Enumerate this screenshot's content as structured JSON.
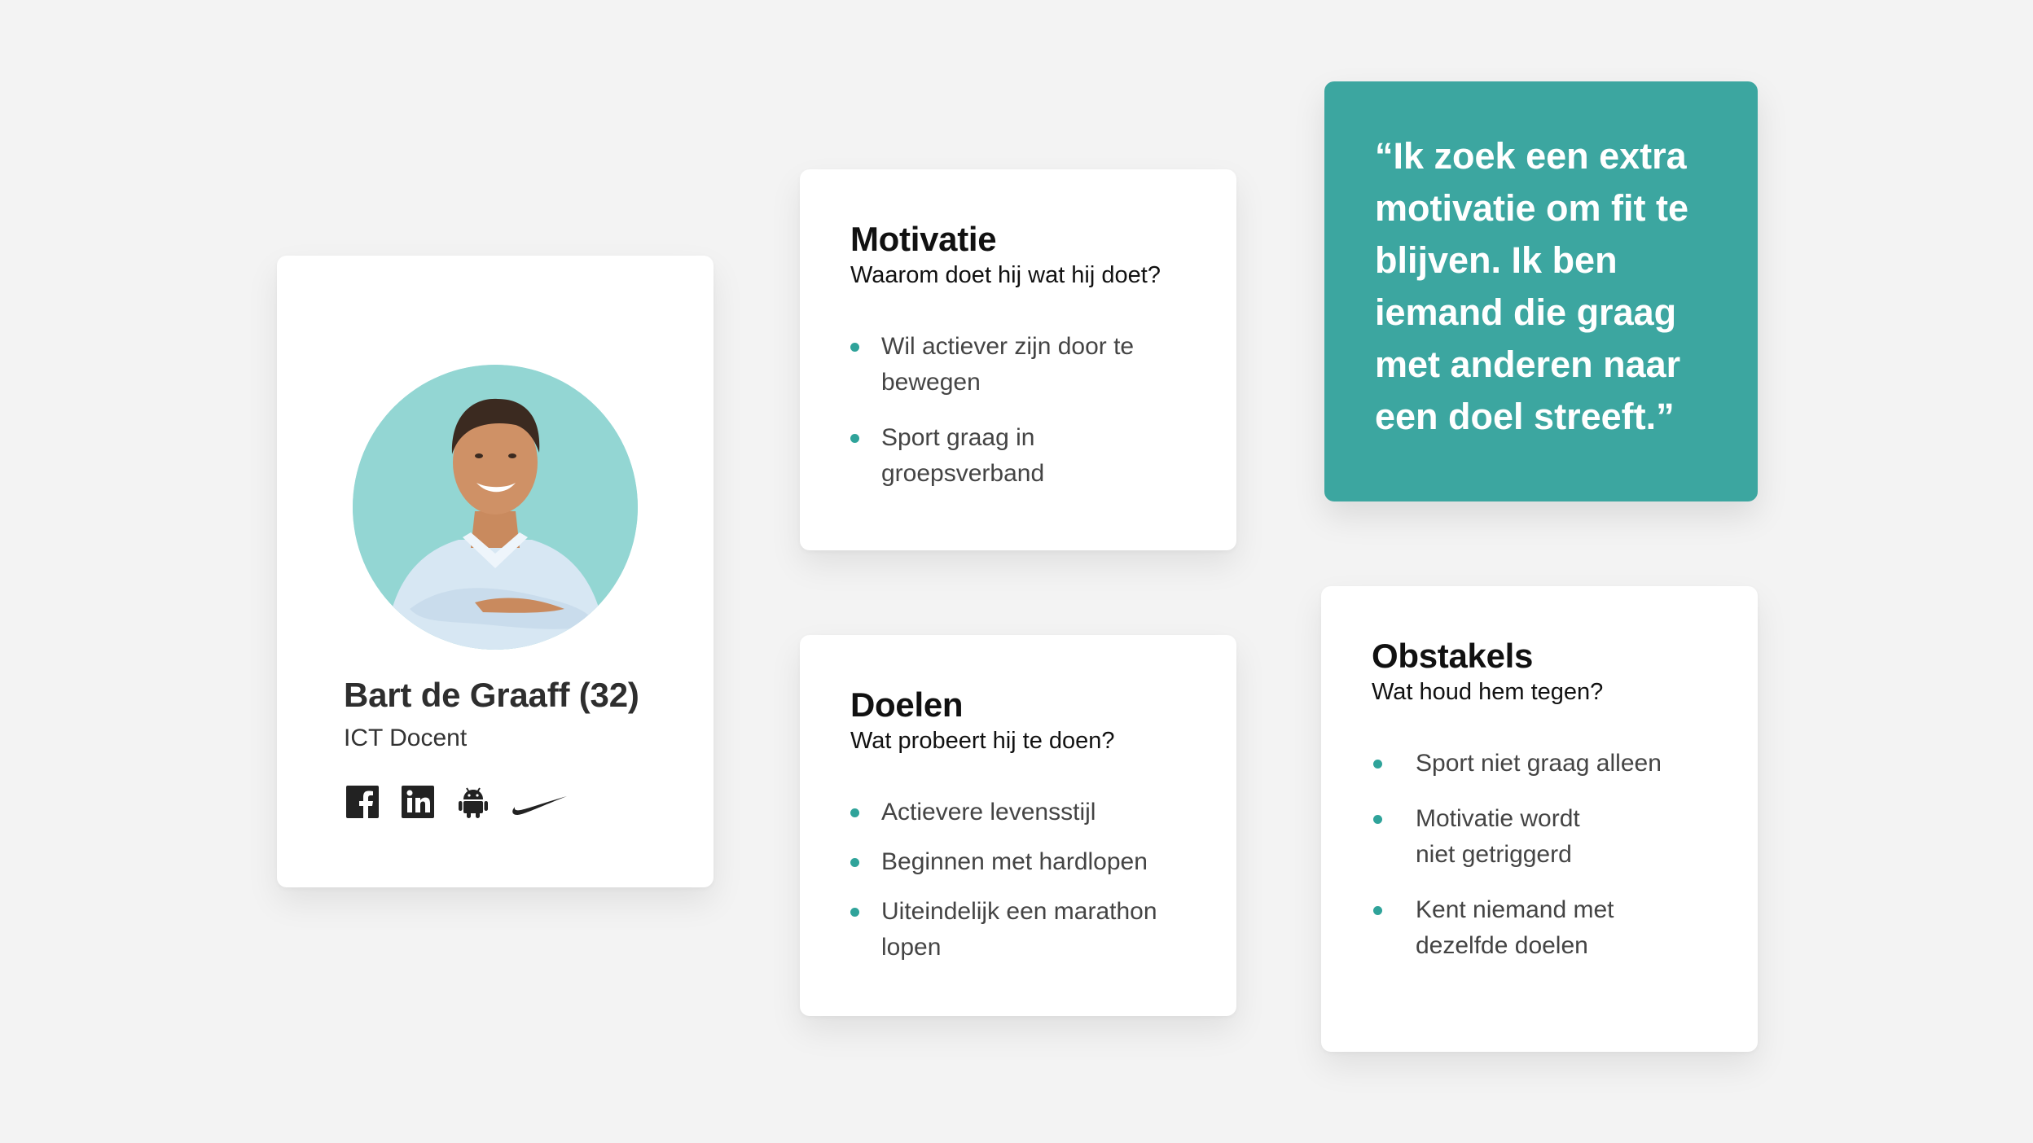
{
  "profile": {
    "name": "Bart de Graaff (32)",
    "role": "ICT Docent",
    "socials": [
      "facebook-icon",
      "linkedin-icon",
      "android-icon",
      "nike-icon"
    ],
    "avatar_bg": "#93d6d3"
  },
  "motivatie": {
    "title": "Motivatie",
    "subtitle": "Waarom doet hij wat hij doet?",
    "items": [
      [
        "Wil actiever zijn door te",
        "bewegen"
      ],
      [
        "Sport graag in",
        "groepsverband"
      ]
    ]
  },
  "doelen": {
    "title": "Doelen",
    "subtitle": "Wat probeert hij te doen?",
    "items": [
      [
        "Actievere levensstijl"
      ],
      [
        "Beginnen met hardlopen"
      ],
      [
        "Uiteindelijk een marathon",
        "lopen"
      ]
    ]
  },
  "obstakels": {
    "title": "Obstakels",
    "subtitle": "Wat houd hem tegen?",
    "items": [
      [
        "Sport niet graag alleen"
      ],
      [
        "Motivatie wordt",
        "niet getriggerd"
      ],
      [
        "Kent niemand met",
        "dezelfde doelen"
      ]
    ]
  },
  "quote": {
    "text": "“Ik zoek een extra motivatie om fit te blijven. Ik ben iemand die graag met anderen naar een doel streeft.”",
    "color": "#3ca6a0"
  },
  "colors": {
    "accent": "#2fa39a",
    "background": "#f3f3f3"
  }
}
